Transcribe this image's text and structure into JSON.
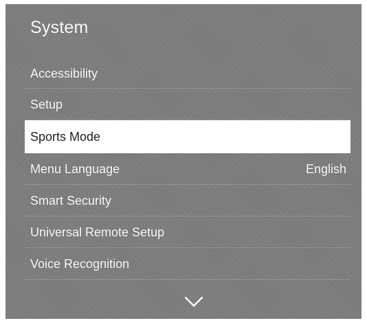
{
  "menu": {
    "title": "System",
    "items": [
      {
        "label": "Accessibility",
        "value": ""
      },
      {
        "label": "Setup",
        "value": ""
      },
      {
        "label": "Sports Mode",
        "value": "",
        "selected": true
      },
      {
        "label": "Menu Language",
        "value": "English"
      },
      {
        "label": "Smart Security",
        "value": ""
      },
      {
        "label": "Universal Remote Setup",
        "value": ""
      },
      {
        "label": "Voice Recognition",
        "value": ""
      }
    ]
  },
  "icons": {
    "scroll_indicator": "chevron-down-icon"
  },
  "colors": {
    "panel": "#7d7d7d",
    "text": "#ffffff",
    "selected_background": "#ffffff",
    "selected_text": "#222222"
  }
}
